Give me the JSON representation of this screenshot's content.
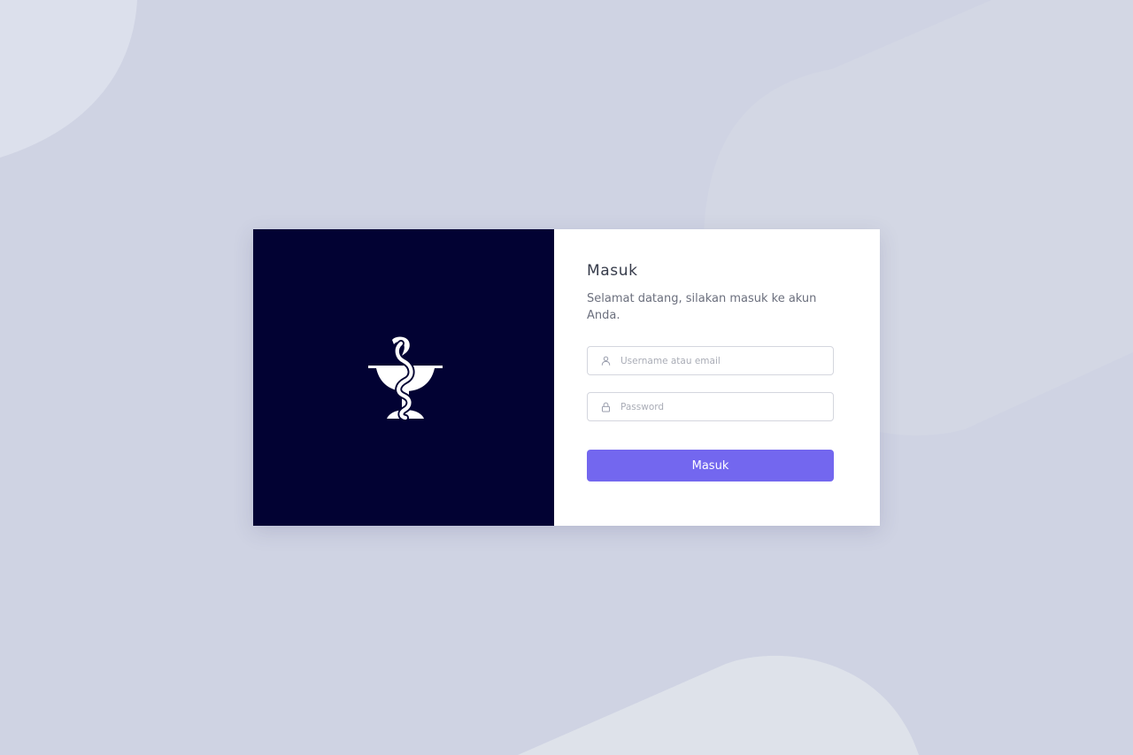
{
  "colors": {
    "background": "#cfd3e3",
    "brand_panel": "#020233",
    "accent": "#7367ef",
    "card": "#ffffff"
  },
  "brand": {
    "icon": "bowl-of-hygieia-icon"
  },
  "login": {
    "title": "Masuk",
    "subtitle": "Selamat datang, silakan masuk ke akun Anda.",
    "username": {
      "placeholder": "Username atau email",
      "value": "",
      "icon": "user-icon"
    },
    "password": {
      "placeholder": "Password",
      "value": "",
      "icon": "lock-icon"
    },
    "submit_label": "Masuk"
  }
}
